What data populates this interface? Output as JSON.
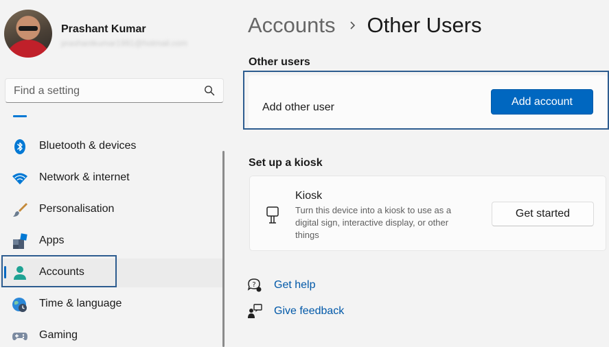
{
  "profile": {
    "name": "Prashant Kumar",
    "email": "prashantkumar1991@hotmail.com"
  },
  "search": {
    "placeholder": "Find a setting",
    "icon": "search-icon"
  },
  "nav": {
    "items": [
      {
        "label": "Bluetooth & devices",
        "icon": "bluetooth-icon"
      },
      {
        "label": "Network & internet",
        "icon": "wifi-icon"
      },
      {
        "label": "Personalisation",
        "icon": "paintbrush-icon"
      },
      {
        "label": "Apps",
        "icon": "apps-icon"
      },
      {
        "label": "Accounts",
        "icon": "accounts-icon",
        "active": true
      },
      {
        "label": "Time & language",
        "icon": "globe-clock-icon"
      },
      {
        "label": "Gaming",
        "icon": "gamepad-icon"
      }
    ]
  },
  "breadcrumb": {
    "parent": "Accounts",
    "current": "Other Users"
  },
  "other_users": {
    "section_title": "Other users",
    "add_label": "Add other user",
    "add_button": "Add account"
  },
  "kiosk": {
    "section_title": "Set up a kiosk",
    "title": "Kiosk",
    "description": "Turn this device into a kiosk to use as a digital sign, interactive display, or other things",
    "button": "Get started"
  },
  "links": {
    "help": "Get help",
    "feedback": "Give feedback"
  },
  "colors": {
    "accent": "#0067c0",
    "focus_outline": "#2d5c8f",
    "link": "#0058a8"
  }
}
